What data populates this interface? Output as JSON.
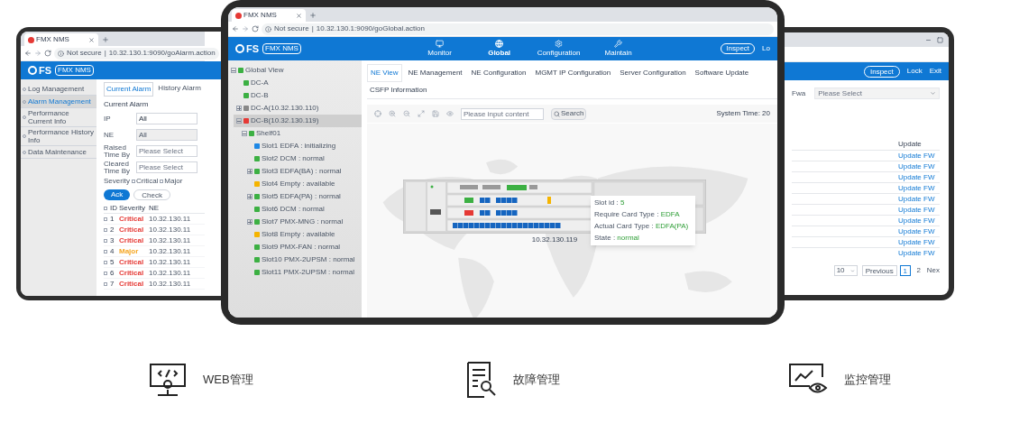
{
  "left_tablet": {
    "browser_tab": "FMX NMS",
    "address": {
      "security": "Not secure",
      "separator": "|",
      "url": "10.32.130.1:9090/goAlarm.action"
    },
    "logo": "FS",
    "product_badge": "FMX NMS",
    "sidebar": [
      {
        "label": "Log Management",
        "selected": false
      },
      {
        "label": "Alarm Management",
        "selected": true
      },
      {
        "label": "Performance Current Info",
        "selected": false
      },
      {
        "label": "Performance History Info",
        "selected": false
      },
      {
        "label": "Data Maintenance",
        "selected": false
      }
    ],
    "tabs": [
      {
        "label": "Current Alarm",
        "selected": true
      },
      {
        "label": "History Alarm",
        "selected": false
      }
    ],
    "section_title": "Current Alarm",
    "filters": [
      {
        "label": "IP",
        "value": "All",
        "disabled": false
      },
      {
        "label": "NE",
        "value": "All",
        "disabled": true
      },
      {
        "label": "Raised Time By",
        "placeholder": "Please Select",
        "disabled": false
      },
      {
        "label": "Cleared Time By",
        "placeholder": "Please Select",
        "disabled": false
      }
    ],
    "severity": {
      "label": "Severity",
      "options": [
        {
          "label": "Critical",
          "checked": false
        },
        {
          "label": "Major",
          "checked": false
        }
      ]
    },
    "buttons": [
      {
        "label": "Ack",
        "kind": "primary"
      },
      {
        "label": "Check",
        "kind": "outline"
      }
    ],
    "table": {
      "columns": [
        "ID",
        "Severity",
        "NE"
      ],
      "rows": [
        {
          "id": "1",
          "severity": "Critical",
          "color": "#e53935",
          "checked": false,
          "ne": "10.32.130.11"
        },
        {
          "id": "2",
          "severity": "Critical",
          "color": "#e53935",
          "checked": false,
          "ne": "10.32.130.11"
        },
        {
          "id": "3",
          "severity": "Critical",
          "color": "#e53935",
          "checked": false,
          "ne": "10.32.130.11"
        },
        {
          "id": "4",
          "severity": "Major",
          "color": "#f5a623",
          "checked": false,
          "ne": "10.32.130.11"
        },
        {
          "id": "5",
          "severity": "Critical",
          "color": "#e53935",
          "checked": false,
          "ne": "10.32.130.11"
        },
        {
          "id": "6",
          "severity": "Critical",
          "color": "#e53935",
          "checked": false,
          "ne": "10.32.130.11"
        },
        {
          "id": "7",
          "severity": "Critical",
          "color": "#e53935",
          "checked": false,
          "ne": "10.32.130.11"
        }
      ]
    }
  },
  "center_tablet": {
    "browser_tab": "FMX NMS",
    "address": {
      "security": "Not secure",
      "separator": "|",
      "url": "10.32.130.1:9090/goGlobal.action"
    },
    "logo": "FS",
    "product_badge": "FMX NMS",
    "nav": [
      {
        "label": "Monitor",
        "kind": "monitor",
        "selected": false
      },
      {
        "label": "Global",
        "kind": "globe",
        "selected": true
      },
      {
        "label": "Configuration",
        "kind": "gear",
        "selected": false
      },
      {
        "label": "Maintain",
        "kind": "tools",
        "selected": false
      }
    ],
    "header_buttons": [
      {
        "label": "Inspect",
        "kind": "outline"
      },
      {
        "label": "Lo",
        "kind": "link"
      }
    ],
    "tree": [
      {
        "label": "Global View",
        "color": "#3cb043",
        "expanded": true,
        "children": [
          {
            "label": "DC-A",
            "color": "#3cb043"
          },
          {
            "label": "DC-B",
            "color": "#3cb043"
          },
          {
            "label": "DC-A(10.32.130.110)",
            "color": "#888888",
            "expanded": false
          },
          {
            "label": "DC-B(10.32.130.119)",
            "color": "#e53935",
            "expanded": true,
            "selected": true,
            "children": [
              {
                "label": "Shelf01",
                "color": "#3cb043",
                "expanded": true,
                "children": [
                  {
                    "label": "Slot1 EDFA : initializing",
                    "color": "#1e88e5"
                  },
                  {
                    "label": "Slot2 DCM : normal",
                    "color": "#3cb043"
                  },
                  {
                    "label": "Slot3 EDFA(BA) : normal",
                    "color": "#3cb043",
                    "expanded": false
                  },
                  {
                    "label": "Slot4 Empty : available",
                    "color": "#f5b400"
                  },
                  {
                    "label": "Slot5 EDFA(PA) : normal",
                    "color": "#3cb043",
                    "expanded": false
                  },
                  {
                    "label": "Slot6 DCM : normal",
                    "color": "#3cb043"
                  },
                  {
                    "label": "Slot7 PMX-MNG : normal",
                    "color": "#3cb043",
                    "expanded": false
                  },
                  {
                    "label": "Slot8 Empty : available",
                    "color": "#f5b400"
                  },
                  {
                    "label": "Slot9 PMX-FAN : normal",
                    "color": "#3cb043"
                  },
                  {
                    "label": "Slot10 PMX-2UPSM : normal",
                    "color": "#3cb043"
                  },
                  {
                    "label": "Slot11 PMX-2UPSM : normal",
                    "color": "#3cb043"
                  }
                ]
              }
            ]
          }
        ]
      }
    ],
    "tabs": [
      {
        "label": "NE View",
        "selected": true
      },
      {
        "label": "NE Management",
        "selected": false
      },
      {
        "label": "NE Configuration",
        "selected": false
      },
      {
        "label": "MGMT IP Configuration",
        "selected": false
      },
      {
        "label": "Server Configuration",
        "selected": false
      },
      {
        "label": "Software Update",
        "selected": false
      },
      {
        "label": "CSFP Information",
        "selected": false
      }
    ],
    "search": {
      "placeholder": "Please input content",
      "button": "Search"
    },
    "system_time": "System Time:  20",
    "tooltip": [
      {
        "label": "Slot id :",
        "value": "5"
      },
      {
        "label": "Require Card Type :",
        "value": "EDFA"
      },
      {
        "label": "Actual Card Type :",
        "value": "EDFA(PA)"
      },
      {
        "label": "State :",
        "value": "normal"
      }
    ],
    "device_label": "10.32.130.119"
  },
  "right_tablet": {
    "header_buttons": [
      {
        "label": "Inspect",
        "kind": "outline"
      },
      {
        "label": "Lock",
        "kind": "link"
      },
      {
        "label": "Exit",
        "kind": "link"
      }
    ],
    "filter": {
      "label": "Fwa",
      "placeholder": "Please Select"
    },
    "table": {
      "column": "Update",
      "rows": [
        "Update FW",
        "Update FW",
        "Update FW",
        "Update FW",
        "Update FW",
        "Update FW",
        "Update FW",
        "Update FW",
        "Update FW",
        "Update FW"
      ]
    },
    "pagination": {
      "page_size": "10",
      "previous": "Previous",
      "pages": [
        {
          "label": "1",
          "selected": true
        },
        {
          "label": "2",
          "selected": false
        }
      ],
      "next": "Nex"
    }
  },
  "features": [
    {
      "label": "WEB管理",
      "kind": "web"
    },
    {
      "label": "故障管理",
      "kind": "fault"
    },
    {
      "label": "监控管理",
      "kind": "monitor"
    }
  ]
}
